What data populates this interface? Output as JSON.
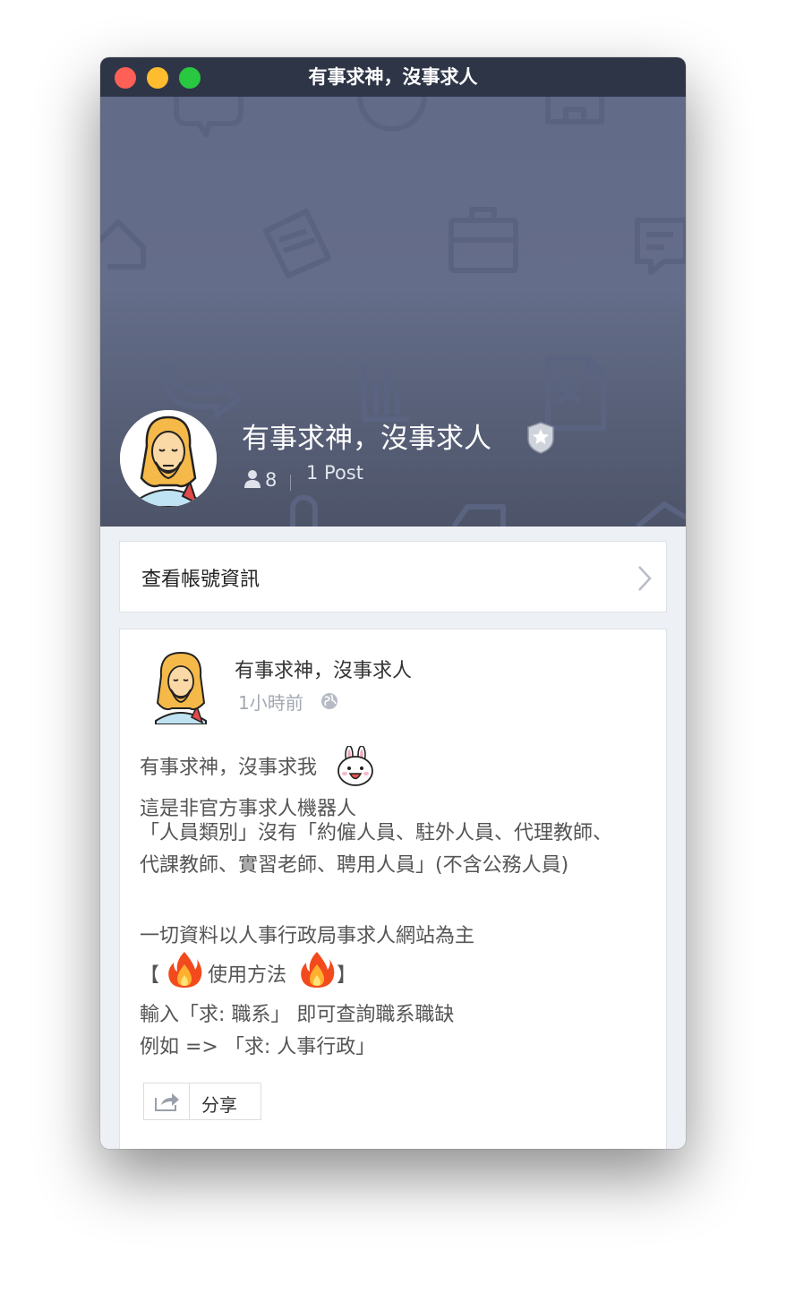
{
  "window": {
    "title": "有事求神，沒事求人"
  },
  "profile": {
    "name": "有事求神，沒事求人",
    "followers": "8",
    "posts": "1 Post"
  },
  "account_info": {
    "label": "查看帳號資訊"
  },
  "post": {
    "author": "有事求神，沒事求人",
    "time": "1小時前",
    "lines": {
      "l1": "有事求神，沒事求我",
      "l2": "這是非官方事求人機器人",
      "l3": "「人員類別」沒有「約僱人員、駐外人員、代理教師、代課教師、實習老師、聘用人員」(不含公務人員)",
      "l4": "一切資料以人事行政局事求人網站為主",
      "l5_open": "【",
      "l5_text": "使用方法",
      "l5_close": "】",
      "l6": "輸入「求: 職系」 即可查詢職系職缺",
      "l7": "例如 => 「求:  人事行政」"
    },
    "share_label": "分享"
  },
  "colors": {
    "titlebar": "#2e3547",
    "cover": "#626b88",
    "background": "#edf0f4",
    "traffic_red": "#fe5f57",
    "traffic_yellow": "#febc2e",
    "traffic_green": "#28c840"
  },
  "icons": [
    "shield-badge-icon",
    "person-icon",
    "chevron-right-icon",
    "globe-icon",
    "bunny-emoji-icon",
    "fire-emoji-icon",
    "share-icon"
  ]
}
